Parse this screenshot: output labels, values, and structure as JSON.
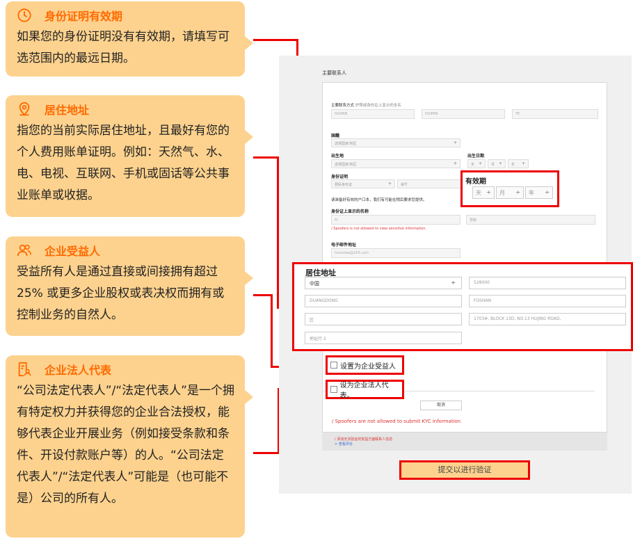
{
  "cards": [
    {
      "title": "身份证明有效期",
      "icon": "clock-icon",
      "body": "如果您的身份证明没有有效期，请填写可选范围内的最远日期。"
    },
    {
      "title": "居住地址",
      "icon": "location-pin-icon",
      "body": "指您的当前实际居住地址，且最好有您的个人费用账单证明。例如：天然气、水、电、电视、互联网、手机或固话等公共事业账单或收据。"
    },
    {
      "title": "企业受益人",
      "icon": "users-icon",
      "body": "受益所有人是通过直接或间接拥有超过 25% 或更多企业股权或表决权而拥有或控制业务的自然人。"
    },
    {
      "title": "企业法人代表",
      "icon": "document-person-icon",
      "body": "“公司法定代表人”/“法定代表人”是一个拥有特定权力并获得您的企业合法授权，能够代表企业开展业务（例如接受条款和条件、开设付款账户等）的人。“公司法定代表人”/“法定代表人”可能是（也可能不是）公司的所有人。"
    }
  ],
  "form": {
    "heading": "主要联系人",
    "contact_label": "主要联系方式",
    "contact_hint": "护照或身份证上显示的全名",
    "name_fields": [
      "HUIMIN",
      "HUIMIN",
      "YE"
    ],
    "country_label": "国籍",
    "country_placeholder": "选择国家/地区",
    "birthplace_label": "出生地",
    "birthplace_placeholder": "选择国家/地区",
    "dob_label": "出生日期",
    "dob_parts": [
      "天",
      "月",
      "年"
    ],
    "id_label": "身份证明",
    "id_type": "居民身份证",
    "id_number": "编号",
    "upload_hint": "请准备好有效的户口本，我们有可能在稍后要求您提供。",
    "id_name_label": "身份证上显示的名称",
    "id_name_values": [
      "叶",
      "慧敏"
    ],
    "spoof_note": "Spoofers is not allowed to view sensitive information.",
    "email_label": "电子邮件地址",
    "email_value": "huiumbe@163.com",
    "cancel": "取消",
    "spoof_warn": "Spoofers are not allowed to submit KYC information",
    "bar_warn": "添加无法验证的受益方面联系人信息",
    "bar_link": "查看评论"
  },
  "highlights": {
    "expiry": {
      "title": "有效期",
      "parts": [
        "天",
        "月",
        "年"
      ]
    },
    "address": {
      "title": "居住地址",
      "country": "中国",
      "postcode": "528000",
      "province": "GUANGDONG",
      "city": "FOSHAN",
      "district": "区",
      "street": "1703#, BLOCK 13D, NO.13 HUJING ROAD,",
      "address2": "地址行 2"
    },
    "beneficiary": "设置为企业受益人",
    "legalrep": "设为企业法人代表。",
    "submit": "提交以进行验证"
  }
}
